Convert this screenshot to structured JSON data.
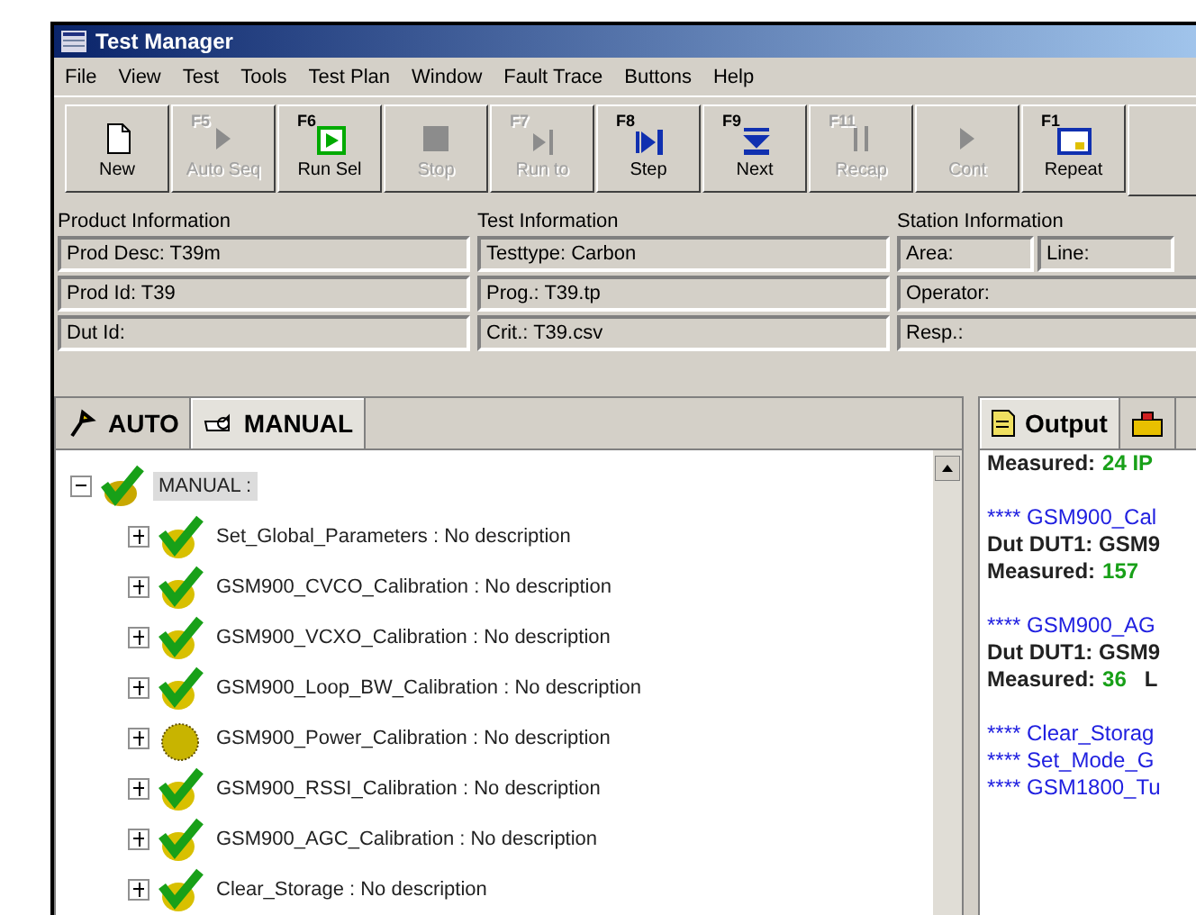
{
  "window": {
    "title": "Test Manager"
  },
  "menu": [
    "File",
    "View",
    "Test",
    "Tools",
    "Test Plan",
    "Window",
    "Fault Trace",
    "Buttons",
    "Help"
  ],
  "toolbar": [
    {
      "kind": "new",
      "label": "New",
      "disabled": false
    },
    {
      "kind": "play",
      "key": "F5",
      "label": "Auto Seq",
      "disabled": true
    },
    {
      "kind": "runsel",
      "key": "F6",
      "label": "Run Sel",
      "disabled": false
    },
    {
      "kind": "stop",
      "label": "Stop",
      "disabled": true
    },
    {
      "kind": "runto",
      "key": "F7",
      "label": "Run to",
      "disabled": true
    },
    {
      "kind": "step",
      "key": "F8",
      "label": "Step",
      "disabled": false
    },
    {
      "kind": "next",
      "key": "F9",
      "label": "Next",
      "disabled": false
    },
    {
      "kind": "recap",
      "key": "F11",
      "label": "Recap",
      "disabled": true
    },
    {
      "kind": "cont",
      "label": "Cont",
      "disabled": true
    },
    {
      "kind": "repeat",
      "key": "F1",
      "label": "Repeat",
      "disabled": false
    }
  ],
  "info": [
    {
      "heading": "Product Information",
      "fields": [
        [
          "Prod Desc: T39m"
        ],
        [
          "Prod Id: T39"
        ],
        [
          "Dut Id:"
        ]
      ]
    },
    {
      "heading": "Test Information",
      "fields": [
        [
          "Testtype: Carbon"
        ],
        [
          "Prog.: T39.tp"
        ],
        [
          "Crit.: T39.csv"
        ]
      ]
    },
    {
      "heading": "Station Information",
      "fields": [
        [
          "Area:",
          "Line:"
        ],
        [
          "Operator:"
        ],
        [
          "Resp.:"
        ]
      ]
    }
  ],
  "left_tabs": [
    {
      "label": "AUTO",
      "kind": "auto",
      "selected": false
    },
    {
      "label": "MANUAL",
      "kind": "manual",
      "selected": true
    }
  ],
  "tree": {
    "label": "MANUAL :",
    "kind": "pass",
    "expanded": true,
    "selected": true,
    "children": [
      {
        "label": "Set_Global_Parameters : No description",
        "kind": "pass",
        "expanded": false
      },
      {
        "label": "GSM900_CVCO_Calibration : No description",
        "kind": "pass",
        "expanded": false
      },
      {
        "label": "GSM900_VCXO_Calibration : No description",
        "kind": "pass",
        "expanded": false
      },
      {
        "label": "GSM900_Loop_BW_Calibration : No description",
        "kind": "pass",
        "expanded": false
      },
      {
        "label": "GSM900_Power_Calibration : No description",
        "kind": "pending",
        "expanded": false
      },
      {
        "label": "GSM900_RSSI_Calibration : No description",
        "kind": "pass",
        "expanded": false
      },
      {
        "label": "GSM900_AGC_Calibration : No description",
        "kind": "pass",
        "expanded": false
      },
      {
        "label": "Clear_Storage : No description",
        "kind": "pass",
        "expanded": false
      }
    ]
  },
  "right_tabs": [
    {
      "label": "Output",
      "kind": "output",
      "selected": true
    },
    {
      "kind": "errors",
      "selected": false
    }
  ],
  "output": [
    {
      "kind": "measured",
      "label": "Measured:",
      "value": "24 IP"
    },
    {
      "kind": "blank"
    },
    {
      "kind": "header",
      "text": "**** GSM900_Cal"
    },
    {
      "kind": "dut",
      "text": "Dut DUT1: GSM9"
    },
    {
      "kind": "measured",
      "label": "Measured:",
      "value": "157"
    },
    {
      "kind": "blank"
    },
    {
      "kind": "header",
      "text": "**** GSM900_AG"
    },
    {
      "kind": "dut",
      "text": "Dut DUT1: GSM9"
    },
    {
      "kind": "measured",
      "label": "Measured:",
      "value": "36",
      "rest": "L"
    },
    {
      "kind": "blank"
    },
    {
      "kind": "header",
      "text": "**** Clear_Storag"
    },
    {
      "kind": "header",
      "text": "**** Set_Mode_G"
    },
    {
      "kind": "header",
      "text": "**** GSM1800_Tu"
    }
  ]
}
